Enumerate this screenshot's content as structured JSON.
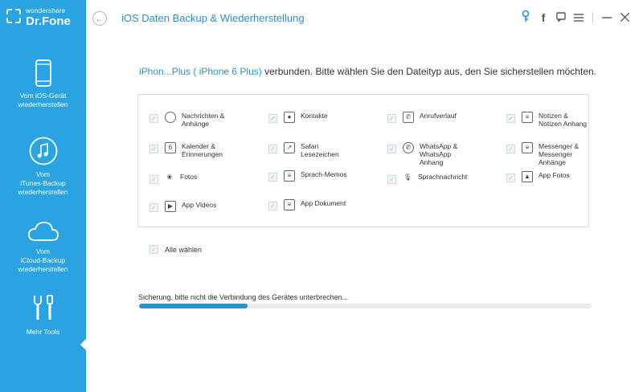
{
  "app": {
    "brand_small": "wondershare",
    "brand_big": "Dr.Fone",
    "title": "iOS Daten Backup & Wiederherstellung"
  },
  "toolbar": {
    "icons": [
      "key-icon",
      "facebook-icon",
      "feedback-icon",
      "menu-icon",
      "minimize-icon",
      "close-icon"
    ]
  },
  "sidebar": {
    "items": [
      {
        "label": "Vom iOS-Gerät\nwiederherstellen",
        "icon": "phone-icon"
      },
      {
        "label": "Vom\niTunes-Backup\nwiederherstellen",
        "icon": "music-icon"
      },
      {
        "label": "Vom\niCloud-Backup\nwiederherstellen",
        "icon": "cloud-icon"
      },
      {
        "label": "Mehr Tools",
        "icon": "tools-icon"
      }
    ]
  },
  "main": {
    "device_name": "iPhon...Plus ( iPhone 6 Plus)",
    "headline_rest": " verbunden. Bitte wählen Sie den Dateityp aus, den Sie sicherstellen möchten.",
    "file_types": [
      {
        "label": "Nachrichten &\nAnhänge",
        "icon": "message-icon"
      },
      {
        "label": "Kontakte",
        "icon": "contacts-icon"
      },
      {
        "label": "Anrufverlauf",
        "icon": "phone-call-icon"
      },
      {
        "label": "Notizen &\nNotizen Anhang",
        "icon": "notes-icon"
      },
      {
        "label": "Kalender &\nErinnerungen",
        "icon": "calendar-icon"
      },
      {
        "label": "Safari\nLesezeichen",
        "icon": "safari-icon"
      },
      {
        "label": "WhatsApp &\nWhatsApp\nAnhang",
        "icon": "whatsapp-icon"
      },
      {
        "label": "Messenger &\nMessenger\nAnhänge",
        "icon": "messenger-icon"
      },
      {
        "label": "Fotos",
        "icon": "photos-icon"
      },
      {
        "label": "Sprach-Memos",
        "icon": "voice-memo-icon"
      },
      {
        "label": "Sprachnachricht",
        "icon": "voicemail-icon"
      },
      {
        "label": "App Fotos",
        "icon": "app-photos-icon"
      },
      {
        "label": "App Videos",
        "icon": "app-videos-icon"
      },
      {
        "label": "App Dokument",
        "icon": "app-document-icon"
      }
    ],
    "select_all_label": "Alle wählen",
    "status_text": "Sicherung, bitte nicht die Verbindung des Gerätes unterbrechen...",
    "progress": 0.24
  },
  "colors": {
    "accent": "#2aa3e2",
    "link": "#2a8fd0"
  }
}
